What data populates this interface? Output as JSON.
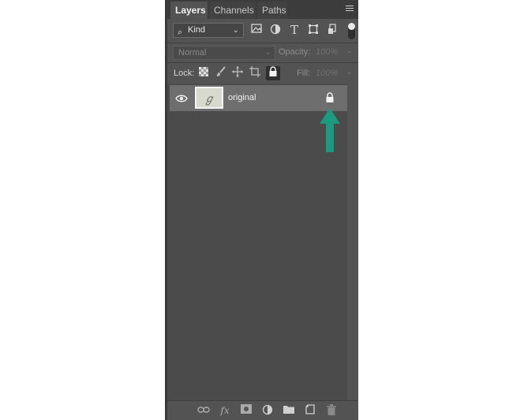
{
  "tabs": [
    {
      "label": "Layers",
      "active": true
    },
    {
      "label": "Channels",
      "active": false
    },
    {
      "label": "Paths",
      "active": false
    }
  ],
  "filter": {
    "kind_label": "Kind",
    "icons": [
      "image-filter-icon",
      "adjustment-filter-icon",
      "type-filter-icon",
      "shape-filter-icon",
      "smart-object-filter-icon"
    ],
    "type_glyph": "T"
  },
  "blend": {
    "mode": "Normal",
    "opacity_label": "Opacity:",
    "opacity_value": "100%"
  },
  "lock": {
    "label": "Lock:",
    "fill_label": "Fill:",
    "fill_value": "100%"
  },
  "layers": [
    {
      "name": "original",
      "visible": true,
      "locked": true
    }
  ],
  "bottom_bar": {
    "fx_label": "fx"
  },
  "colors": {
    "panel_bg": "#535353",
    "list_bg": "#4b4b4b",
    "selected_row": "#6e6e6e",
    "arrow": "#1a9a80"
  }
}
